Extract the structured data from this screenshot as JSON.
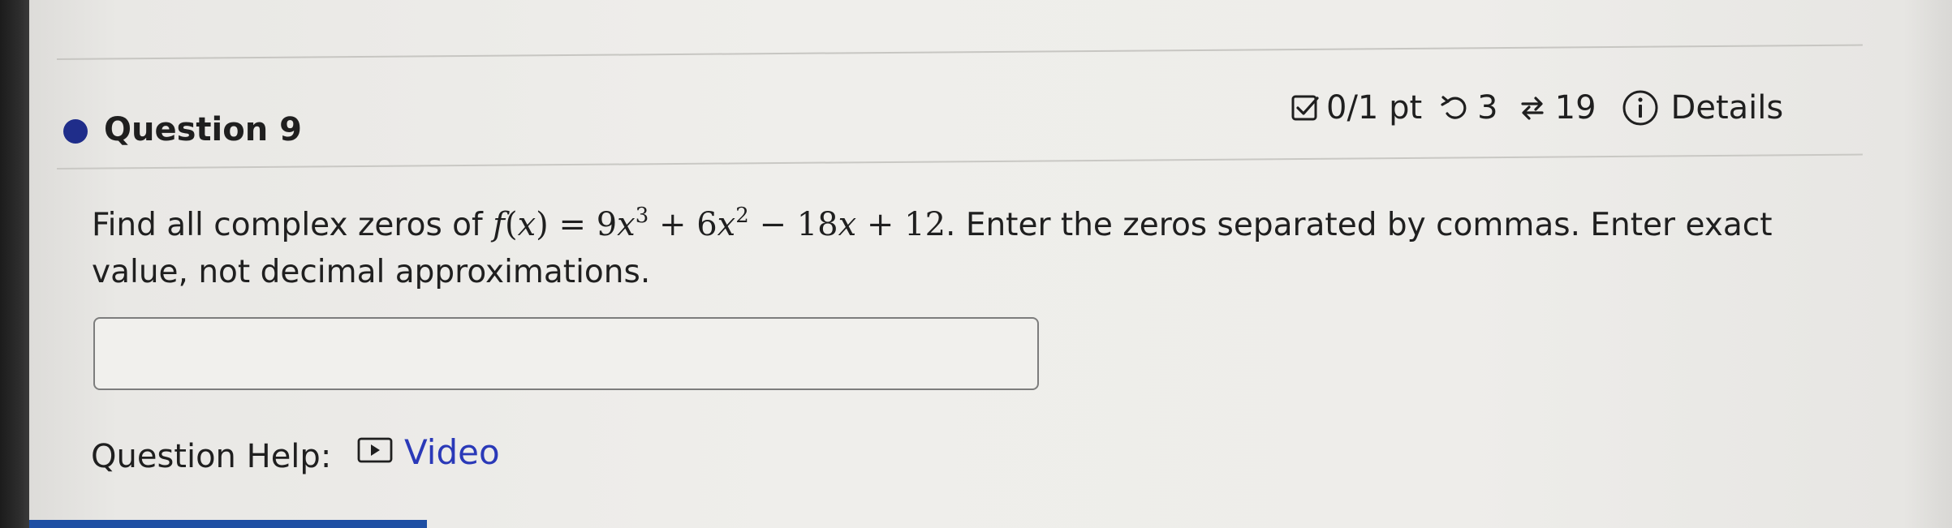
{
  "question": {
    "title": "Question 9",
    "score": "0/1 pt",
    "retries": "3",
    "attempts": "19",
    "details_label": "Details",
    "prompt_before": "Find all complex zeros of ",
    "prompt_after": ". Enter the zeros separated by commas. Enter exact value, not decimal approximations.",
    "math": {
      "f": "f",
      "x": "x",
      "equals": " = 9",
      "exp3": "3",
      "plus6": " + 6",
      "exp2": "2",
      "minus18": " − 18",
      "plus12": " + 12"
    },
    "answer_value": "",
    "help_label": "Question Help:",
    "video_label": "Video"
  },
  "colors": {
    "status_dot": "#1f2d8a",
    "link": "#2a39b8",
    "accent_bar": "#1e4fa3"
  },
  "icons": [
    "checkbox-icon",
    "retry-icon",
    "attempts-icon",
    "info-icon",
    "video-play-icon"
  ]
}
